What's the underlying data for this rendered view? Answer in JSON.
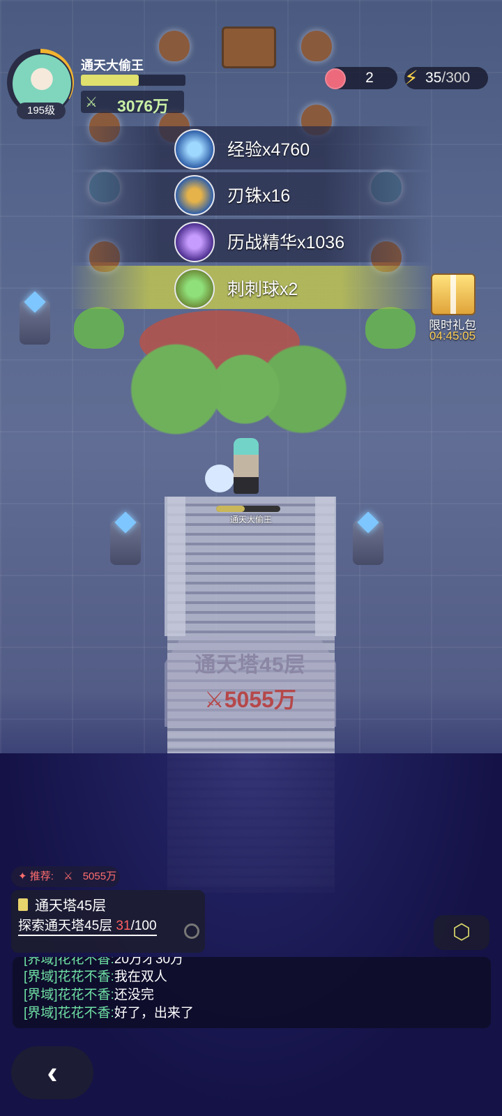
{
  "player": {
    "name": "通天大偷王",
    "level": "195级",
    "power": "3076万",
    "exp_fraction": 0.55
  },
  "resources": {
    "apple_count": "2",
    "energy_current": "35",
    "energy_max": "/300"
  },
  "rewards": [
    {
      "label": "经验x4760",
      "icon": "exp-orb-icon"
    },
    {
      "label": "刃铢x16",
      "icon": "blade-coin-icon"
    },
    {
      "label": "历战精华x1036",
      "icon": "battle-essence-icon"
    },
    {
      "label": "刺刺球x2",
      "icon": "spiky-ball-icon"
    }
  ],
  "gift": {
    "label": "限时礼包",
    "timer": "04:45:05"
  },
  "hero": {
    "name": "通天大偷王",
    "hp_fraction": 0.45
  },
  "stage": {
    "title": "通天塔45层",
    "power": "5055万"
  },
  "recommend": {
    "prefix": "✦ 推荐: ",
    "power": "5055万"
  },
  "quest": {
    "title": "通天塔45层",
    "desc": "探索通天塔45层 ",
    "current": "31",
    "total": "/100"
  },
  "chat": [
    {
      "channel": "[界域]花花不香:",
      "message": "20万才30万"
    },
    {
      "channel": "[界域]花花不香:",
      "message": "我在双人"
    },
    {
      "channel": "[界域]花花不香:",
      "message": "还没完"
    },
    {
      "channel": "[界域]花花不香:",
      "message": "好了，出来了"
    }
  ],
  "colors": {
    "power_green": "#c9f0a5",
    "danger_red": "#ff6060",
    "chat_channel": "#6fe1a5",
    "highlight_row": "#bec352"
  }
}
